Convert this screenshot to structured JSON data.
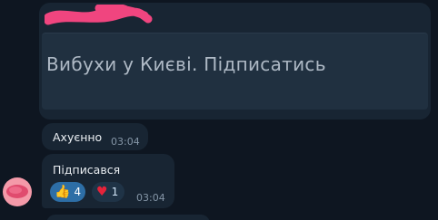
{
  "preview": {
    "text": "Вибухи у Києві.  Підписатись"
  },
  "messages": [
    {
      "text": "Ахуєнно",
      "time": "03:04"
    },
    {
      "text": "Підписався",
      "time": "03:04"
    }
  ],
  "reactions": [
    {
      "emoji": "👍",
      "count": "4",
      "icon": "thumbs-up-icon"
    },
    {
      "emoji": "♥",
      "count": "1",
      "icon": "heart-icon"
    }
  ],
  "colors": {
    "background": "#0e1621",
    "bubble": "#182533",
    "accent_reaction": "#2d6ea6",
    "redaction": "#f0457f",
    "avatar": "#f49aa9"
  }
}
